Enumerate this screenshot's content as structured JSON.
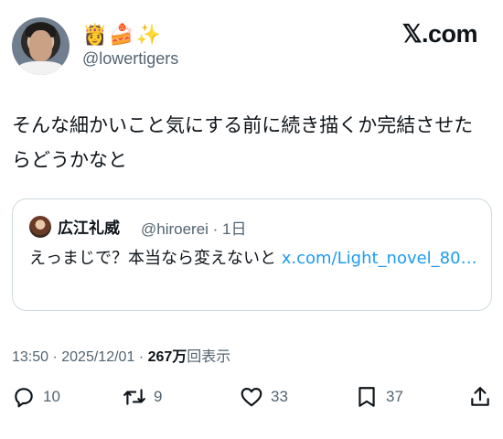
{
  "author": {
    "display_name": "👸🍰✨",
    "handle": "@lowertigers"
  },
  "brand": "𝕏.com",
  "tweet": {
    "text": "そんな細かいこと気にする前に続き描くか完結させたらどうかなと"
  },
  "quote": {
    "name": "広江礼威",
    "meta": "@hiroerei · 1日",
    "body": "えっまじで？本当なら変えないと ",
    "link": "x.com/Light_novel_80…"
  },
  "timestamp": {
    "time_date": "13:50 · 2025/12/01 · ",
    "views_count": "267万",
    "views_label": "回表示"
  },
  "actions": {
    "reply_count": "10",
    "retweet_count": "9",
    "like_count": "33",
    "bookmark_count": "37"
  }
}
